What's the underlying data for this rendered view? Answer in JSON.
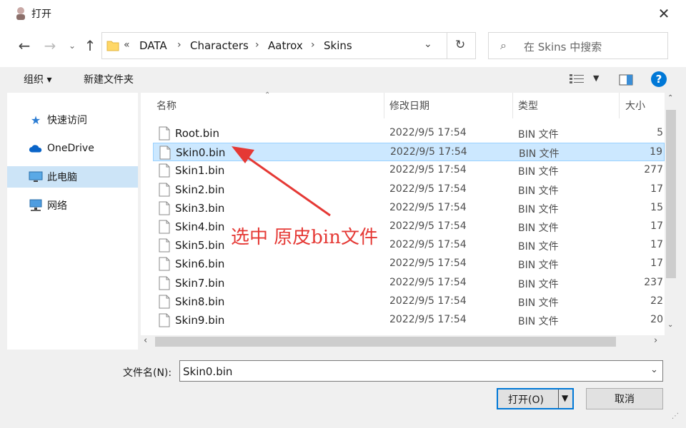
{
  "window": {
    "title": "打开",
    "close_label": "✕"
  },
  "address": {
    "overflow": "«",
    "crumbs": [
      "DATA",
      "Characters",
      "Aatrox",
      "Skins"
    ],
    "search_placeholder": "在 Skins 中搜索"
  },
  "toolbar": {
    "organize": "组织 ▾",
    "new_folder": "新建文件夹"
  },
  "sidebar": {
    "items": [
      {
        "label": "快速访问",
        "icon": "star-icon"
      },
      {
        "label": "OneDrive",
        "icon": "cloud-icon"
      },
      {
        "label": "此电脑",
        "icon": "computer-icon",
        "selected": true
      },
      {
        "label": "网络",
        "icon": "network-icon"
      }
    ]
  },
  "list": {
    "columns": [
      "名称",
      "修改日期",
      "类型",
      "大小"
    ],
    "rows": [
      {
        "name": "Root.bin",
        "date": "2022/9/5 17:54",
        "type": "BIN 文件",
        "size": "5"
      },
      {
        "name": "Skin0.bin",
        "date": "2022/9/5 17:54",
        "type": "BIN 文件",
        "size": "19",
        "selected": true
      },
      {
        "name": "Skin1.bin",
        "date": "2022/9/5 17:54",
        "type": "BIN 文件",
        "size": "277"
      },
      {
        "name": "Skin2.bin",
        "date": "2022/9/5 17:54",
        "type": "BIN 文件",
        "size": "17"
      },
      {
        "name": "Skin3.bin",
        "date": "2022/9/5 17:54",
        "type": "BIN 文件",
        "size": "15"
      },
      {
        "name": "Skin4.bin",
        "date": "2022/9/5 17:54",
        "type": "BIN 文件",
        "size": "17"
      },
      {
        "name": "Skin5.bin",
        "date": "2022/9/5 17:54",
        "type": "BIN 文件",
        "size": "17"
      },
      {
        "name": "Skin6.bin",
        "date": "2022/9/5 17:54",
        "type": "BIN 文件",
        "size": "17"
      },
      {
        "name": "Skin7.bin",
        "date": "2022/9/5 17:54",
        "type": "BIN 文件",
        "size": "237"
      },
      {
        "name": "Skin8.bin",
        "date": "2022/9/5 17:54",
        "type": "BIN 文件",
        "size": "22"
      },
      {
        "name": "Skin9.bin",
        "date": "2022/9/5 17:54",
        "type": "BIN 文件",
        "size": "20"
      }
    ]
  },
  "bottom": {
    "filename_label": "文件名(N):",
    "filename_value": "Skin0.bin",
    "open_label": "打开(O)",
    "cancel_label": "取消"
  },
  "annotation": {
    "text": "选中 原皮bin文件",
    "color": "#e53935"
  },
  "colors": {
    "accent": "#0078d7",
    "selection": "#cce8ff",
    "help": "#0078d7"
  }
}
